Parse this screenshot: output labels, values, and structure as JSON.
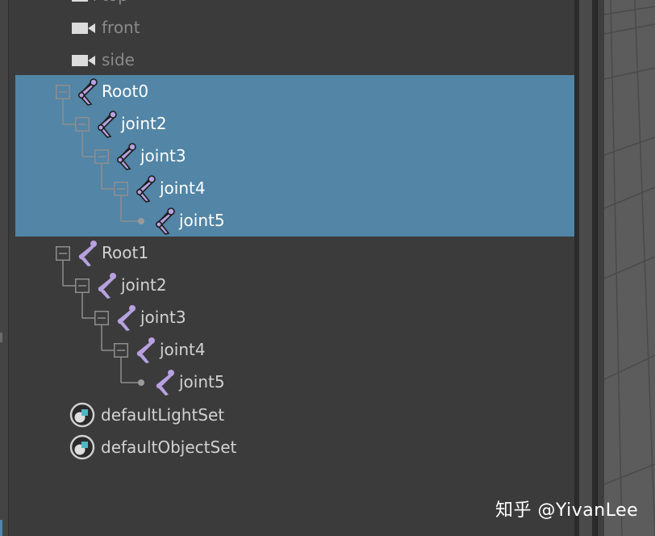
{
  "outliner": {
    "cameras": [
      {
        "label": "top"
      },
      {
        "label": "front"
      },
      {
        "label": "side"
      }
    ],
    "hierarchies": [
      {
        "selected": true,
        "items": [
          {
            "label": "Root0",
            "depth": 0
          },
          {
            "label": "joint2",
            "depth": 1
          },
          {
            "label": "joint3",
            "depth": 2
          },
          {
            "label": "joint4",
            "depth": 3
          },
          {
            "label": "joint5",
            "depth": 4
          }
        ]
      },
      {
        "selected": false,
        "items": [
          {
            "label": "Root1",
            "depth": 0
          },
          {
            "label": "joint2",
            "depth": 1
          },
          {
            "label": "joint3",
            "depth": 2
          },
          {
            "label": "joint4",
            "depth": 3
          },
          {
            "label": "joint5",
            "depth": 4
          }
        ]
      }
    ],
    "sets": [
      {
        "label": "defaultLightSet"
      },
      {
        "label": "defaultObjectSet"
      }
    ]
  },
  "watermark": {
    "text": "知乎 @YivanLee"
  },
  "colors": {
    "selection": "#5285a6",
    "panel_bg": "#3b3b3b",
    "joint_purple": "#b7a1e0"
  }
}
